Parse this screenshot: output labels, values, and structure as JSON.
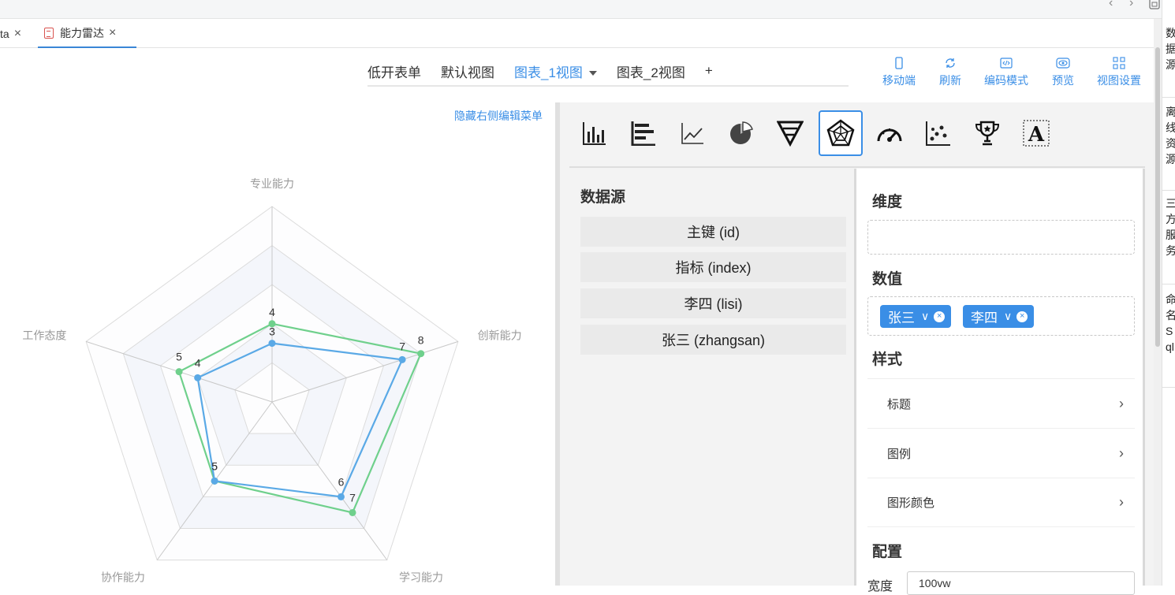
{
  "top_nav": {
    "back": "‹",
    "forward": "›"
  },
  "doc_tabs": [
    {
      "label": "ta",
      "active": false
    },
    {
      "label": "能力雷达",
      "active": true
    }
  ],
  "view_tabs": [
    {
      "label": "低开表单",
      "active": false
    },
    {
      "label": "默认视图",
      "active": false
    },
    {
      "label": "图表_1视图",
      "active": true
    },
    {
      "label": "图表_2视图",
      "active": false
    },
    {
      "label": "+",
      "active": false
    }
  ],
  "toolbar": [
    {
      "label": "移动端",
      "icon": "mobile-icon"
    },
    {
      "label": "刷新",
      "icon": "refresh-icon"
    },
    {
      "label": "编码模式",
      "icon": "code-icon"
    },
    {
      "label": "预览",
      "icon": "eye-icon"
    },
    {
      "label": "视图设置",
      "icon": "grid-settings-icon"
    }
  ],
  "hide_menu_link": "隐藏右侧编辑菜单",
  "chart_types": [
    "bar-chart-icon",
    "horizontal-bar-icon",
    "line-chart-icon",
    "pie-chart-icon",
    "funnel-chart-icon",
    "radar-chart-icon",
    "gauge-chart-icon",
    "scatter-chart-icon",
    "trophy-icon",
    "text-icon"
  ],
  "selected_chart_type": "radar-chart-icon",
  "datasource": {
    "title": "数据源",
    "items": [
      "主键 (id)",
      "指标 (index)",
      "李四 (lisi)",
      "张三 (zhangsan)"
    ]
  },
  "config": {
    "dimension_title": "维度",
    "value_title": "数值",
    "value_chips": [
      "张三",
      "李四"
    ],
    "style_title": "样式",
    "style_rows": [
      "标题",
      "图例",
      "图形颜色"
    ],
    "settings_title": "配置",
    "width_label": "宽度",
    "width_value": "100vw"
  },
  "right_sidebar": [
    "数据源",
    "离线资源",
    "三方服务",
    "命名Sql"
  ],
  "colors": {
    "accent": "#3a8ee6",
    "series_green": "#6fd08c",
    "series_blue": "#5aa9e6"
  },
  "chart_data": {
    "type": "radar",
    "indicators": [
      "专业能力",
      "创新能力",
      "学习能力",
      "协作能力",
      "工作态度"
    ],
    "max": 10,
    "series": [
      {
        "values": [
          4,
          8,
          7,
          5,
          5
        ],
        "color": "#6fd08c"
      },
      {
        "values": [
          3,
          7,
          6,
          5,
          4
        ],
        "color": "#5aa9e6"
      }
    ],
    "legend": false
  }
}
